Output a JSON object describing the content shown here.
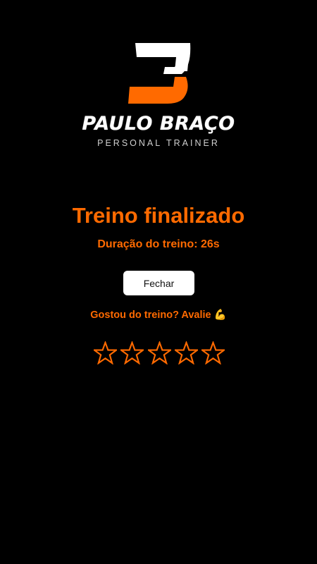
{
  "brand": {
    "logo_letter": "B",
    "name": "PAULO BRAÇO",
    "tagline": "PERSONAL TRAINER"
  },
  "workout": {
    "title": "Treino finalizado",
    "duration_text": "Duração do treino: 26s"
  },
  "actions": {
    "close_label": "Fechar"
  },
  "rating": {
    "prompt": "Gostou do treino? Avalie 💪",
    "max_stars": 5,
    "selected": 0
  },
  "colors": {
    "accent": "#ff6a00",
    "background": "#000000",
    "button_bg": "#ffffff"
  }
}
